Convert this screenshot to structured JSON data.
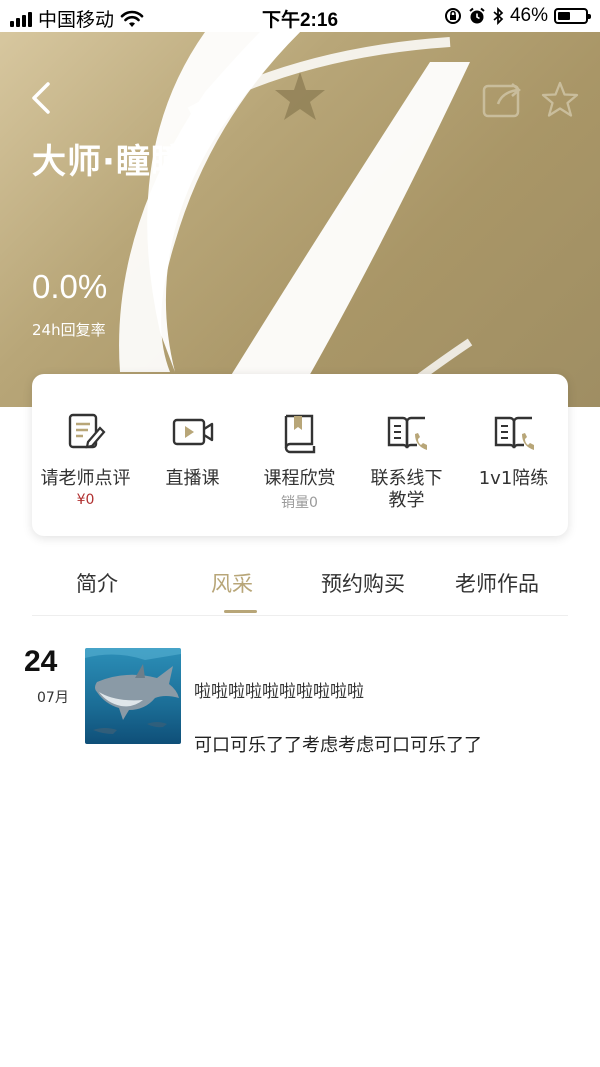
{
  "status_bar": {
    "carrier": "中国移动",
    "time": "下午2:16",
    "battery_percent": "46%",
    "battery_level": 0.46
  },
  "header": {
    "teacher_name": "大师·瞳瞳",
    "reply_rate_value": "0.0%",
    "reply_rate_label": "24h回复率",
    "icons": [
      "back-icon",
      "share-icon",
      "star-icon"
    ]
  },
  "features": [
    {
      "label": "请老师点评",
      "sub": "¥0",
      "icon": "review-icon"
    },
    {
      "label": "直播课",
      "sub": "",
      "icon": "video-icon"
    },
    {
      "label": "课程欣赏",
      "sub": "销量0",
      "icon": "book-icon"
    },
    {
      "label": "联系线下\n教学",
      "sub": "",
      "icon": "book-phone-icon"
    },
    {
      "label": "1v1陪练",
      "sub": "",
      "icon": "book-phone-icon"
    }
  ],
  "tabs": [
    {
      "label": "简介",
      "active": false
    },
    {
      "label": "风采",
      "active": true
    },
    {
      "label": "预约购买",
      "active": false
    },
    {
      "label": "老师作品",
      "active": false
    }
  ],
  "colors": {
    "accent": "#b8a678",
    "price": "#b03030"
  },
  "posts": [
    {
      "day": "24",
      "month": "07月",
      "title": "啦啦啦啦啦啦啦啦啦啦",
      "body": "可口可乐了了考虑考虑可口可乐了了",
      "image": "shark-photo"
    }
  ]
}
